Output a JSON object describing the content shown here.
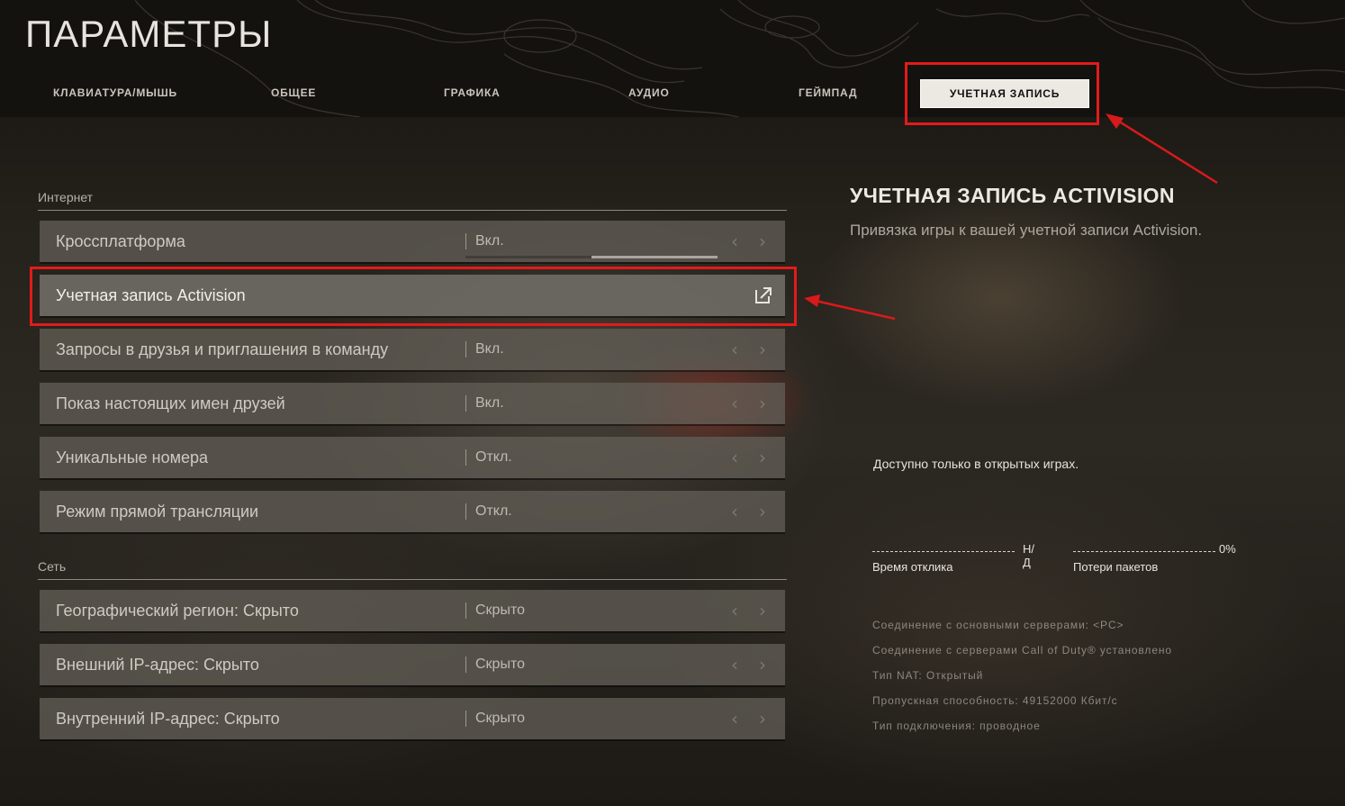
{
  "title": "ПАРАМЕТРЫ",
  "tabs": [
    {
      "label": "КЛАВИАТУРА/МЫШЬ",
      "active": false
    },
    {
      "label": "ОБЩЕЕ",
      "active": false
    },
    {
      "label": "ГРАФИКА",
      "active": false
    },
    {
      "label": "АУДИО",
      "active": false
    },
    {
      "label": "ГЕЙМПАД",
      "active": false
    },
    {
      "label": "УЧЕТНАЯ ЗАПИСЬ",
      "active": true
    }
  ],
  "sections": {
    "internet": {
      "label": "Интернет",
      "rows": [
        {
          "label": "Кроссплатформа",
          "value": "Вкл.",
          "slider_fraction": 0.5
        },
        {
          "label": "Учетная запись Activision",
          "icon": "external-link-icon"
        },
        {
          "label": "Запросы в друзья и приглашения в команду",
          "value": "Вкл."
        },
        {
          "label": "Показ настоящих имен друзей",
          "value": "Вкл."
        },
        {
          "label": "Уникальные номера",
          "value": "Откл."
        },
        {
          "label": "Режим прямой трансляции",
          "value": "Откл."
        }
      ]
    },
    "network": {
      "label": "Сеть",
      "rows": [
        {
          "label": "Географический регион: Скрыто",
          "value": "Скрыто"
        },
        {
          "label": "Внешний IP-адрес: Скрыто",
          "value": "Скрыто"
        },
        {
          "label": "Внутренний IP-адрес: Скрыто",
          "value": "Скрыто"
        }
      ]
    }
  },
  "info": {
    "title": "УЧЕТНАЯ ЗАПИСЬ ACTIVISION",
    "description": "Привязка игры к вашей учетной записи Activision.",
    "only_open": "Доступно только в открытых играх.",
    "latency": {
      "value": "Н/Д",
      "label": "Время отклика"
    },
    "packet_loss": {
      "value": "0%",
      "label": "Потери пакетов"
    },
    "network_lines": [
      "Соединение с основными серверами: <PC>",
      "Соединение с серверами Call of Duty® установлено",
      "Тип NAT: Открытый",
      "Пропускная способность: 49152000 Кбит/с",
      "Тип подключения: проводное"
    ]
  },
  "colors": {
    "highlight": "#e21b1b",
    "active_tab_bg": "#ece9e3"
  }
}
